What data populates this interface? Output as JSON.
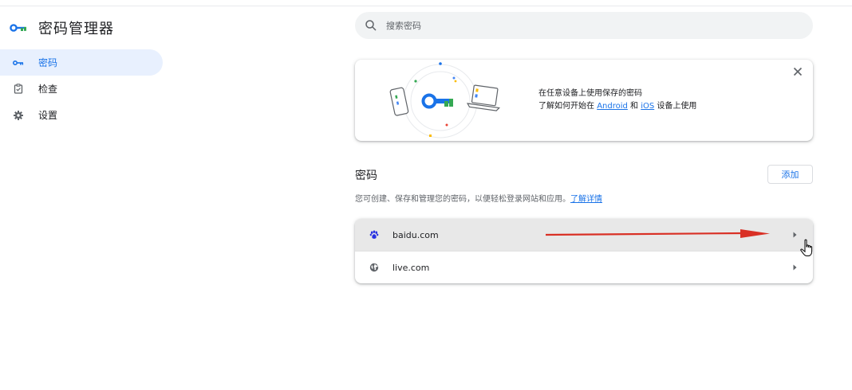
{
  "app": {
    "title": "密码管理器"
  },
  "sidebar": {
    "items": [
      {
        "label": "密码",
        "icon": "key-icon",
        "active": true
      },
      {
        "label": "检查",
        "icon": "clipboard-check-icon",
        "active": false
      },
      {
        "label": "设置",
        "icon": "gear-icon",
        "active": false
      }
    ]
  },
  "search": {
    "placeholder": "搜索密码"
  },
  "promo": {
    "line1": "在任意设备上使用保存的密码",
    "line2_prefix": "了解如何开始在 ",
    "android_link": "Android",
    "line2_mid": " 和 ",
    "ios_link": "iOS",
    "line2_suffix": " 设备上使用"
  },
  "passwords": {
    "title": "密码",
    "add_label": "添加",
    "description": "您可创建、保存和管理您的密码，以便轻松登录网站和应用。",
    "learn_more": "了解详情",
    "entries": [
      {
        "site": "baidu.com",
        "icon": "baidu-paw-icon",
        "highlighted": true
      },
      {
        "site": "live.com",
        "icon": "globe-icon",
        "highlighted": false
      }
    ]
  },
  "colors": {
    "accent": "#1a73e8",
    "annotation_arrow": "#d93025"
  }
}
